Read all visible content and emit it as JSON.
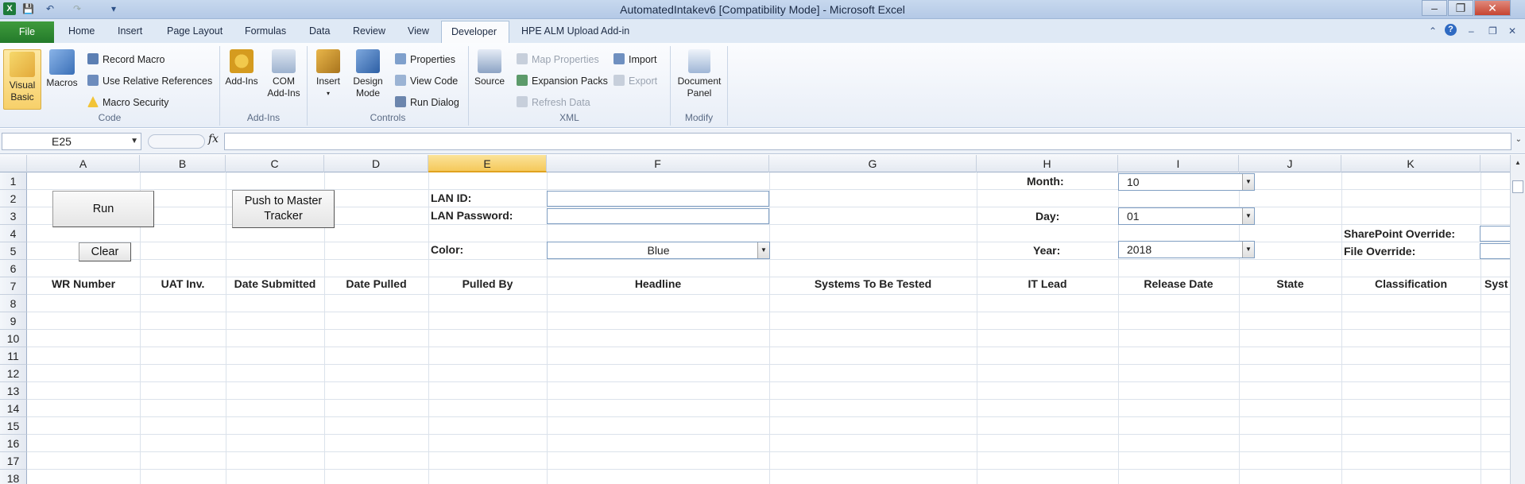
{
  "window": {
    "title": "AutomatedIntakev6  [Compatibility Mode]  -  Microsoft Excel",
    "minimize": "–",
    "restore": "❐",
    "close": "✕"
  },
  "qat": {
    "save": "💾",
    "undo": "↶",
    "redo": "↷",
    "customize": "▾"
  },
  "tabs": [
    {
      "label": "File"
    },
    {
      "label": "Home"
    },
    {
      "label": "Insert"
    },
    {
      "label": "Page Layout"
    },
    {
      "label": "Formulas"
    },
    {
      "label": "Data"
    },
    {
      "label": "Review"
    },
    {
      "label": "View"
    },
    {
      "label": "Developer"
    },
    {
      "label": "HPE ALM Upload Add-in"
    }
  ],
  "active_tab": "Developer",
  "ribbon": {
    "code": {
      "label": "Code",
      "visual_basic": "Visual Basic",
      "macros": "Macros",
      "record_macro": "Record Macro",
      "relative_refs": "Use Relative References",
      "macro_security": "Macro Security"
    },
    "addins": {
      "label": "Add-Ins",
      "addins": "Add-Ins",
      "com_addins": "COM Add-Ins"
    },
    "controls": {
      "label": "Controls",
      "insert": "Insert",
      "design_mode": "Design Mode",
      "properties": "Properties",
      "view_code": "View Code",
      "run_dialog": "Run Dialog"
    },
    "xml": {
      "label": "XML",
      "source": "Source",
      "map_properties": "Map Properties",
      "expansion_packs": "Expansion Packs",
      "refresh_data": "Refresh Data",
      "import": "Import",
      "export": "Export"
    },
    "modify": {
      "label": "Modify",
      "document_panel": "Document Panel"
    }
  },
  "formula_bar": {
    "name_box": "E25",
    "fx": "fx",
    "value": ""
  },
  "columns": [
    "A",
    "B",
    "C",
    "D",
    "E",
    "F",
    "G",
    "H",
    "I",
    "J",
    "K"
  ],
  "selected_column": "E",
  "rows": [
    "1",
    "2",
    "3",
    "4",
    "5",
    "6",
    "7",
    "8",
    "9",
    "10",
    "11",
    "12",
    "13",
    "14",
    "15",
    "16",
    "17",
    "18"
  ],
  "sheet": {
    "run_button": "Run",
    "clear_button": "Clear",
    "push_button": "Push to Master Tracker",
    "lan_id_label": "LAN ID:",
    "lan_password_label": "LAN Password:",
    "color_label": "Color:",
    "color_value": "Blue",
    "month_label": "Month:",
    "month_value": "10",
    "day_label": "Day:",
    "day_value": "01",
    "year_label": "Year:",
    "year_value": "2018",
    "sharepoint_override_label": "SharePoint Override:",
    "file_override_label": "File Override:",
    "headers": [
      "WR Number",
      "UAT Inv.",
      "Date Submitted",
      "Date Pulled",
      "Pulled By",
      "Headline",
      "Systems To Be Tested",
      "IT Lead",
      "Release Date",
      "State",
      "Classification",
      "Syst"
    ]
  }
}
